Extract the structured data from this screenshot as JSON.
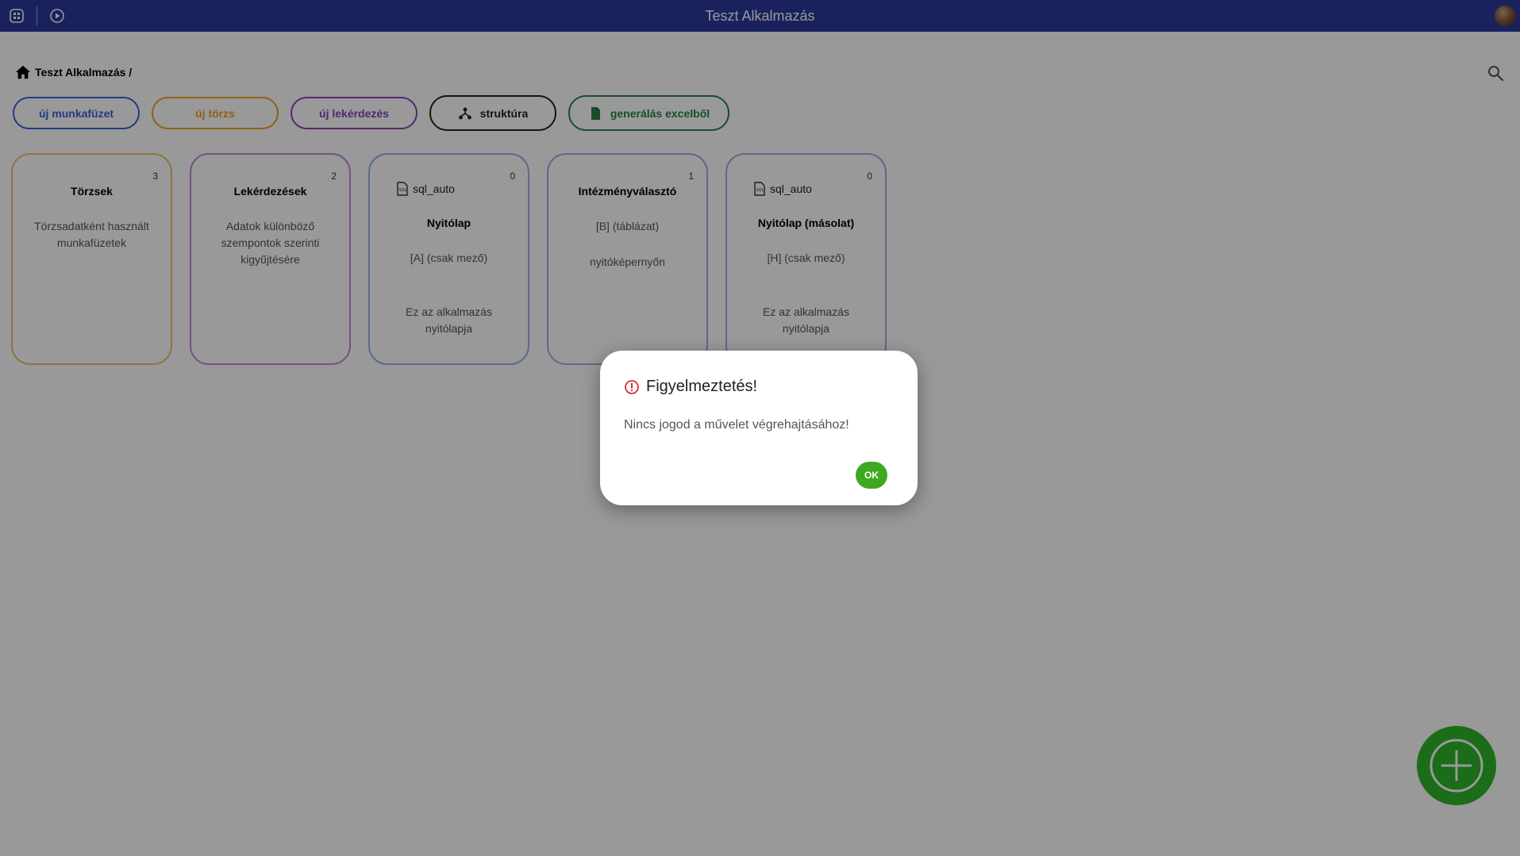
{
  "app": {
    "title": "Teszt Alkalmazás"
  },
  "topbar": {
    "apps_icon": "apps-grid-icon",
    "play_icon": "play-circle-icon"
  },
  "breadcrumb": {
    "label": "Teszt Alkalmazás /"
  },
  "toolbar": {
    "new_workbook": "új munkafüzet",
    "new_master": "új törzs",
    "new_query": "új lekérdezés",
    "structure": "struktúra",
    "generate_excel": "generálás excelből"
  },
  "cards": [
    {
      "count": "3",
      "title": "Törzsek",
      "desc": [
        "Törzsadatként használt",
        "munkafüzetek"
      ]
    },
    {
      "count": "2",
      "title": "Lekérdezések",
      "desc": [
        "Adatok különböző",
        "szempontok szerinti",
        "kigyűjtésére"
      ]
    },
    {
      "count": "0",
      "tag": "sql_auto",
      "title": "Nyitólap",
      "sub": "[A] (csak mező)",
      "desc": [
        "Ez az alkalmazás",
        "nyitólapja"
      ]
    },
    {
      "count": "1",
      "title": "Intézményválasztó",
      "sub": "[B] (táblázat)",
      "desc": [
        "nyitóképernyőn"
      ]
    },
    {
      "count": "0",
      "tag": "sql_auto",
      "title": "Nyitólap (másolat)",
      "sub": "[H] (csak mező)",
      "desc": [
        "Ez az alkalmazás",
        "nyitólapja"
      ]
    }
  ],
  "dialog": {
    "title": "Figyelmeztetés!",
    "message": "Nincs jogod a művelet végrehajtásához!",
    "ok": "OK"
  },
  "colors": {
    "topbar": "#2a3a9c",
    "workbook": "#3f5fd8",
    "master": "#f0a020",
    "query": "#8a3fbf",
    "excel": "#2e7d4a",
    "fab": "#2fb52a",
    "ok": "#3ea820",
    "warning": "#d32f2f"
  }
}
